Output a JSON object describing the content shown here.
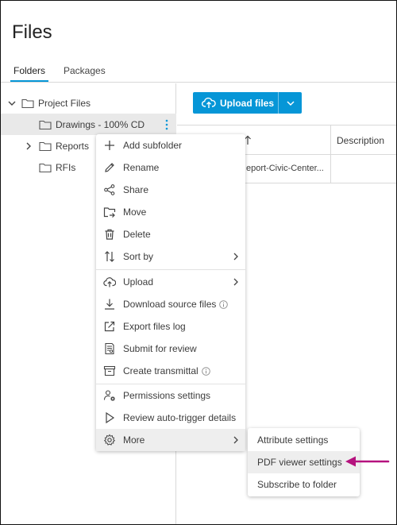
{
  "page": {
    "title": "Files"
  },
  "tabs": [
    {
      "label": "Folders",
      "active": true
    },
    {
      "label": "Packages",
      "active": false
    }
  ],
  "tree": {
    "root": {
      "label": "Project Files",
      "expanded": true
    },
    "children": [
      {
        "label": "Drawings - 100% CD",
        "selected": true,
        "has_children": false
      },
      {
        "label": "Reports",
        "selected": false,
        "has_children": true
      },
      {
        "label": "RFIs",
        "selected": false,
        "has_children": false
      }
    ]
  },
  "toolbar": {
    "upload_label": "Upload files"
  },
  "table": {
    "columns": [
      "",
      "Description"
    ],
    "rows": [
      {
        "name": "eport-Civic-Center...",
        "description": ""
      }
    ]
  },
  "context_menu": {
    "items": [
      {
        "label": "Add subfolder",
        "icon": "plus-icon"
      },
      {
        "label": "Rename",
        "icon": "pencil-icon"
      },
      {
        "label": "Share",
        "icon": "share-icon"
      },
      {
        "label": "Move",
        "icon": "move-folder-icon"
      },
      {
        "label": "Delete",
        "icon": "trash-icon"
      },
      {
        "label": "Sort by",
        "icon": "sort-icon",
        "submenu": true
      },
      {
        "label": "Upload",
        "icon": "cloud-upload-icon",
        "submenu": true
      },
      {
        "label": "Download source files",
        "icon": "download-icon",
        "info": true
      },
      {
        "label": "Export files log",
        "icon": "export-icon"
      },
      {
        "label": "Submit for review",
        "icon": "review-document-icon"
      },
      {
        "label": "Create transmittal",
        "icon": "transmittal-icon",
        "info": true
      },
      {
        "label": "Permissions settings",
        "icon": "user-gear-icon"
      },
      {
        "label": "Review auto-trigger details",
        "icon": "play-icon"
      },
      {
        "label": "More",
        "icon": "gear-icon",
        "submenu": true,
        "hovered": true
      }
    ]
  },
  "more_submenu": {
    "items": [
      {
        "label": "Attribute settings"
      },
      {
        "label": "PDF viewer settings",
        "hovered": true
      },
      {
        "label": "Subscribe to folder"
      }
    ]
  },
  "colors": {
    "accent": "#0696d7",
    "annotation_arrow": "#b5127e",
    "selected_row": "#e9e9e9"
  }
}
